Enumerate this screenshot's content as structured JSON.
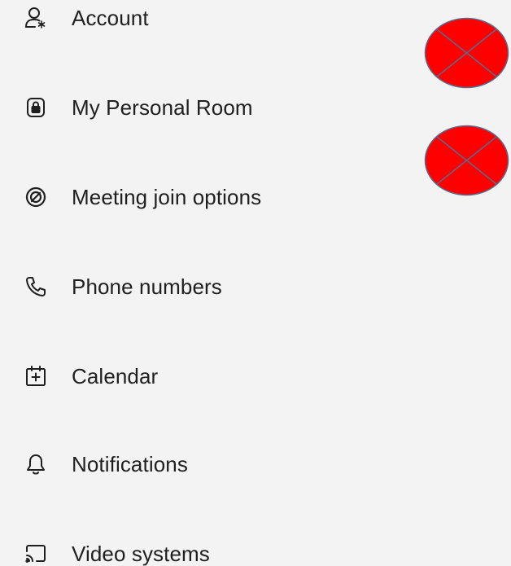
{
  "menu": {
    "items": [
      {
        "label": "Account",
        "icon": "account-settings-icon"
      },
      {
        "label": "My Personal Room",
        "icon": "personal-room-lock-icon"
      },
      {
        "label": "Meeting join options",
        "icon": "join-options-icon"
      },
      {
        "label": "Phone numbers",
        "icon": "phone-icon"
      },
      {
        "label": "Calendar",
        "icon": "calendar-add-icon"
      },
      {
        "label": "Notifications",
        "icon": "bell-icon"
      },
      {
        "label": "Video systems",
        "icon": "cast-screen-icon"
      }
    ]
  },
  "overlay_marks": [
    {
      "name": "red-x-mark",
      "fill": "#ff0000",
      "stroke": "#5a6b8c"
    },
    {
      "name": "red-x-mark",
      "fill": "#ff0000",
      "stroke": "#5a6b8c"
    }
  ],
  "colors": {
    "background": "#f3f3f3",
    "text": "#1f1f1f",
    "icon": "#1f1f1f"
  }
}
